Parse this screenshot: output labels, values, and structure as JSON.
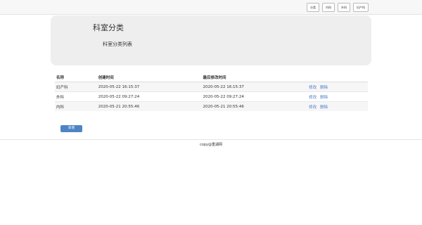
{
  "nav": {
    "items": [
      "分类",
      "内科",
      "外科",
      "妇产科"
    ]
  },
  "hero": {
    "title": "科室分类",
    "subtitle": "科室分类列表"
  },
  "table": {
    "headers": [
      "名称",
      "创建时间",
      "最后修改时间",
      ""
    ],
    "rows": [
      {
        "name": "妇产科",
        "created": "2020-05-22 16:15:37",
        "modified": "2020-05-22 16:15:37",
        "edit": "修改",
        "delete": "删除"
      },
      {
        "name": "外科",
        "created": "2020-05-22 09:27:24",
        "modified": "2020-05-22 09:27:24",
        "edit": "修改",
        "delete": "删除"
      },
      {
        "name": "内科",
        "created": "2020-05-21 20:55:46",
        "modified": "2020-05-21 20:55:46",
        "edit": "修改",
        "delete": "删除"
      }
    ]
  },
  "new_button": "新增",
  "footer": "copy@重湖网",
  "colors": {
    "accent": "#4f84c4",
    "link": "#4a7cc8",
    "hero_bg": "#eeeeee"
  }
}
